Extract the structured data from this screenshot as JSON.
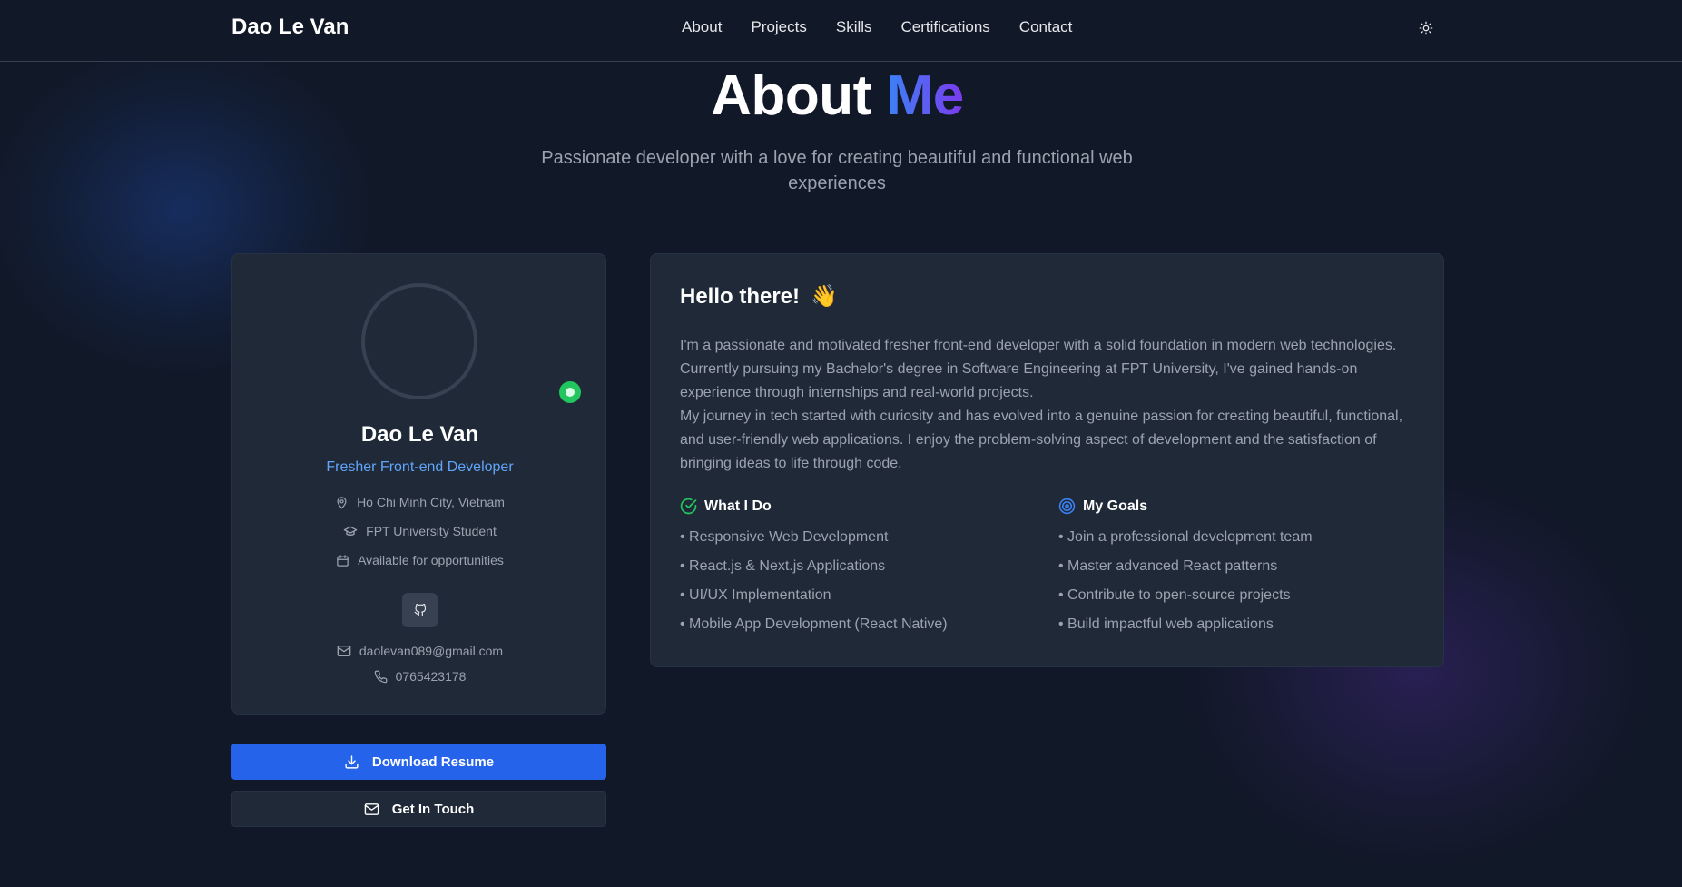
{
  "nav": {
    "brand": "Dao Le Van",
    "links": [
      "About",
      "Projects",
      "Skills",
      "Certifications",
      "Contact"
    ],
    "theme_icon": "sun-icon"
  },
  "hero": {
    "title_main": "About",
    "title_accent": "Me",
    "subtitle": "Passionate developer with a love for creating beautiful and functional web experiences"
  },
  "profile": {
    "name": "Dao Le Van",
    "role": "Fresher Front-end Developer",
    "location": "Ho Chi Minh City, Vietnam",
    "education": "FPT University Student",
    "availability": "Available for opportunities",
    "email": "daolevan089@gmail.com",
    "phone": "0765423178",
    "status_color": "#22c55e"
  },
  "actions": {
    "download": "Download Resume",
    "contact": "Get In Touch",
    "primary_color": "#2563eb"
  },
  "about": {
    "greeting": "Hello there!",
    "greeting_emoji": "👋",
    "bio_1": "I'm a passionate and motivated fresher front-end developer with a solid foundation in modern web technologies. Currently pursuing my Bachelor's degree in Software Engineering at FPT University, I've gained hands-on experience through internships and real-world projects.",
    "bio_2": "My journey in tech started with curiosity and has evolved into a genuine passion for creating beautiful, functional, and user-friendly web applications. I enjoy the problem-solving aspect of development and the satisfaction of bringing ideas to life through code.",
    "what_i_do": {
      "title": "What I Do",
      "items": [
        "• Responsive Web Development",
        "• React.js & Next.js Applications",
        "• UI/UX Implementation",
        "• Mobile App Development (React Native)"
      ]
    },
    "my_goals": {
      "title": "My Goals",
      "items": [
        "• Join a professional development team",
        "• Master advanced React patterns",
        "• Contribute to open-source projects",
        "• Build impactful web applications"
      ]
    }
  }
}
